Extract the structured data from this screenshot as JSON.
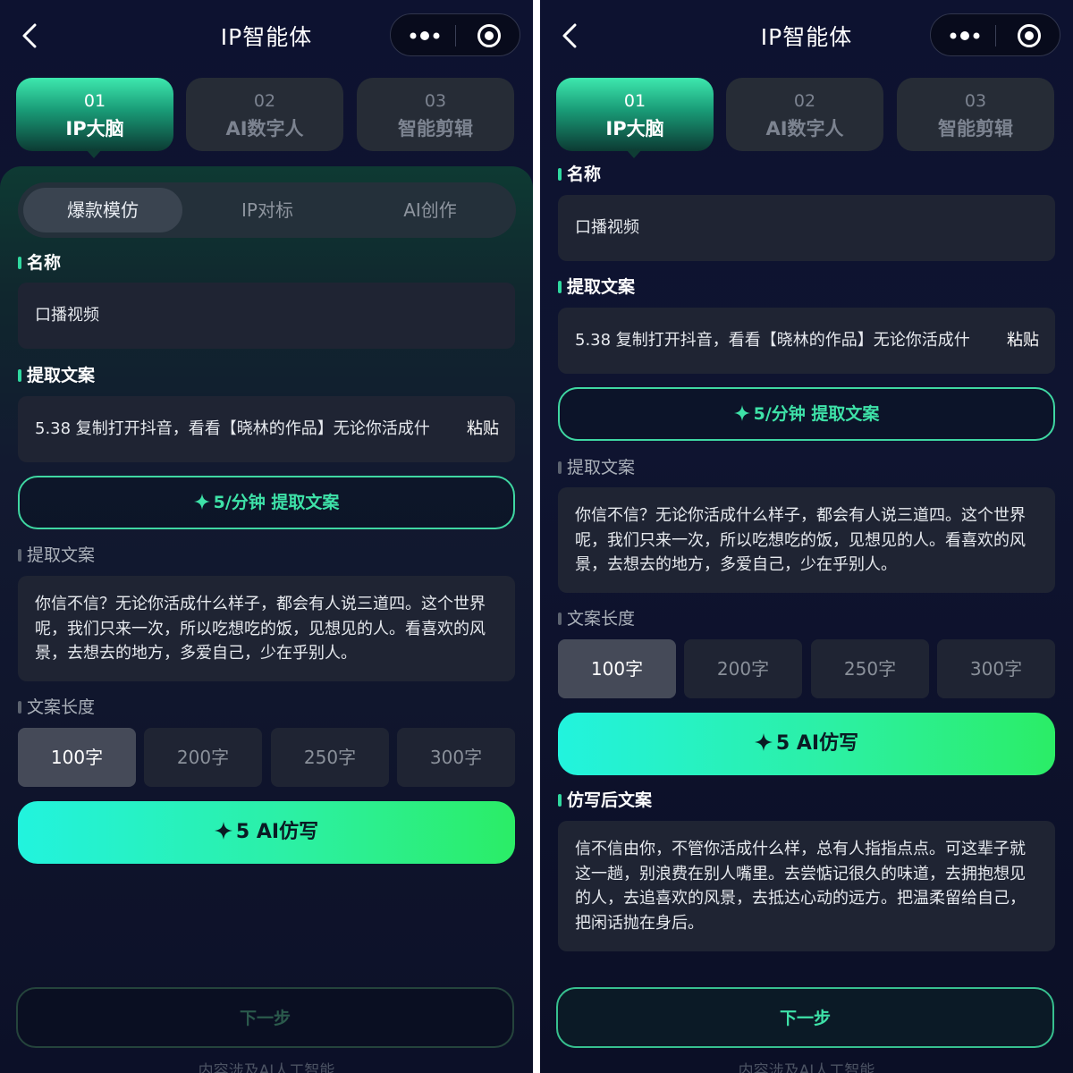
{
  "screens": [
    {
      "nav": {
        "title": "IP智能体",
        "back_icon": "chevron-left-icon",
        "more_icon": "more-dots-icon",
        "close_icon": "target-circle-icon"
      },
      "steps": [
        {
          "num": "01",
          "label": "IP大脑",
          "active": true
        },
        {
          "num": "02",
          "label": "AI数字人",
          "active": false
        },
        {
          "num": "03",
          "label": "智能剪辑",
          "active": false
        }
      ],
      "mode_tabs": [
        "爆款模仿",
        "IP对标",
        "AI创作"
      ],
      "name_section": {
        "label": "名称",
        "value": "口播视频"
      },
      "extract_section": {
        "label": "提取文案",
        "link_text": "5.38 复制打开抖音，看看【晓林的作品】无论你活成什",
        "paste_label": "粘贴"
      },
      "extract_button": {
        "cost": "5",
        "label": "/分钟 提取文案"
      },
      "extracted_section": {
        "label": "提取文案",
        "text": "你信不信？无论你活成什么样子，都会有人说三道四。这个世界呢，我们只来一次，所以吃想吃的饭，见想见的人。看喜欢的风景，去想去的地方，多爱自己，少在乎别人。"
      },
      "length_section": {
        "label": "文案长度",
        "options": [
          "100字",
          "200字",
          "250字",
          "300字"
        ],
        "selected": "100字"
      },
      "rewrite_button": {
        "cost": "5",
        "label": "AI仿写"
      },
      "next_button": {
        "label": "下一步",
        "enabled": false
      },
      "footer": "内容涉及AI人工智能"
    },
    {
      "nav": {
        "title": "IP智能体",
        "back_icon": "chevron-left-icon",
        "more_icon": "more-dots-icon",
        "close_icon": "target-circle-icon"
      },
      "steps": [
        {
          "num": "01",
          "label": "IP大脑",
          "active": true
        },
        {
          "num": "02",
          "label": "AI数字人",
          "active": false
        },
        {
          "num": "03",
          "label": "智能剪辑",
          "active": false
        }
      ],
      "name_section": {
        "label": "名称",
        "value": "口播视频"
      },
      "extract_section": {
        "label": "提取文案",
        "link_text": "5.38 复制打开抖音，看看【晓林的作品】无论你活成什",
        "paste_label": "粘贴"
      },
      "extract_button": {
        "cost": "5",
        "label": "/分钟 提取文案"
      },
      "extracted_section": {
        "label": "提取文案",
        "text": "你信不信？无论你活成什么样子，都会有人说三道四。这个世界呢，我们只来一次，所以吃想吃的饭，见想见的人。看喜欢的风景，去想去的地方，多爱自己，少在乎别人。"
      },
      "length_section": {
        "label": "文案长度",
        "options": [
          "100字",
          "200字",
          "250字",
          "300字"
        ],
        "selected": "100字"
      },
      "rewrite_button": {
        "cost": "5",
        "label": "AI仿写"
      },
      "rewritten_section": {
        "label": "仿写后文案",
        "text": "信不信由你，不管你活成什么样，总有人指指点点。可这辈子就这一趟，别浪费在别人嘴里。去尝惦记很久的味道，去拥抱想见的人，去追喜欢的风景，去抵达心动的远方。把温柔留给自己，把闲话抛在身后。"
      },
      "next_button": {
        "label": "下一步",
        "enabled": true
      },
      "footer": "内容涉及AI人工智能"
    }
  ],
  "colors": {
    "accent": "#2fd89f",
    "background": "#0d1230",
    "field": "#1f2433",
    "gradient_start": "#22f3de",
    "gradient_end": "#2bed66"
  }
}
